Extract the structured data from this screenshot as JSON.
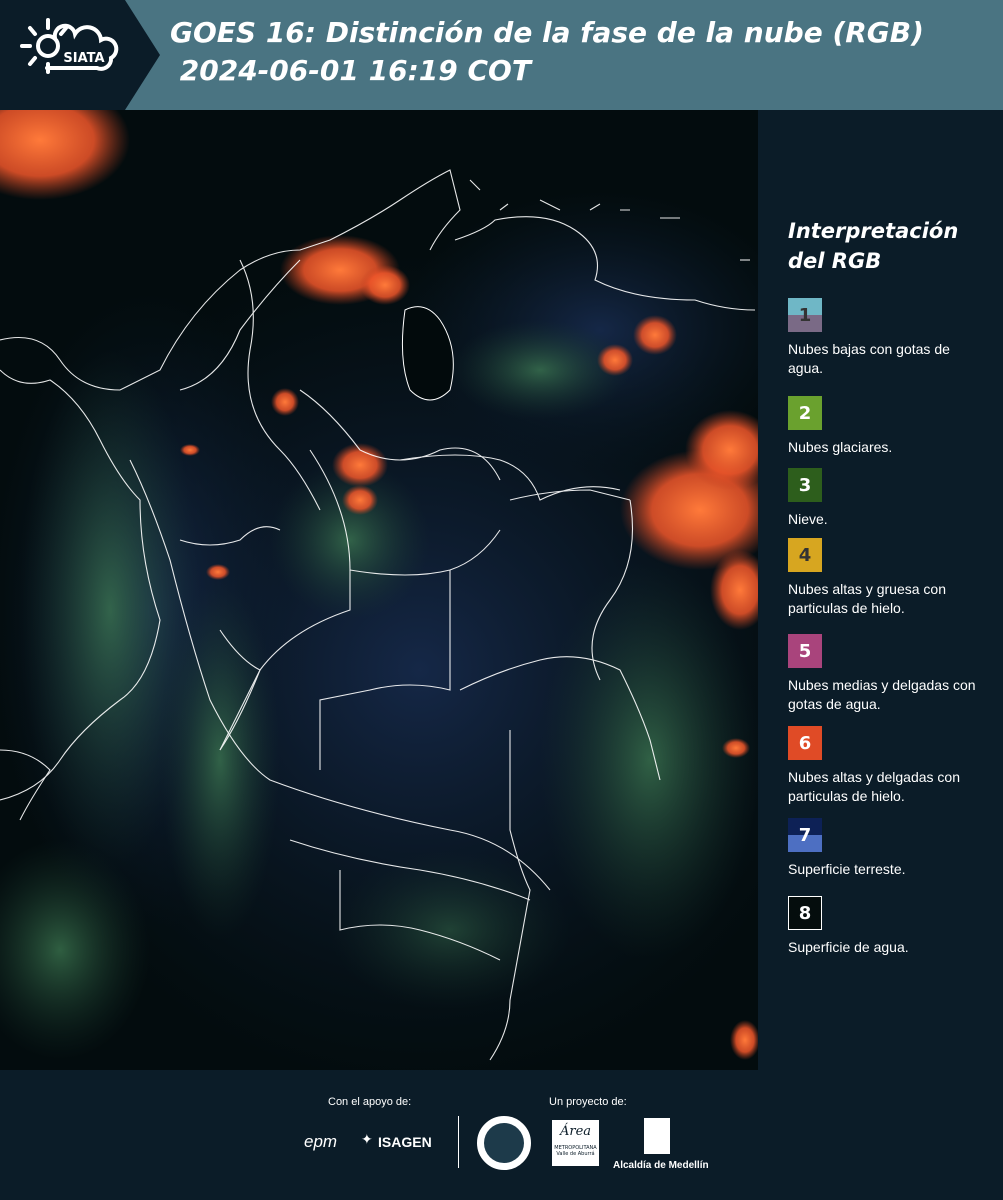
{
  "header": {
    "logo_text": "SIATA",
    "title": "GOES 16: Distinción de la fase de la nube (RGB)\n 2024-06-01 16:19 COT"
  },
  "map": {
    "description_icon": "satellite-rgb-map",
    "colors": {
      "water": "#020b0c",
      "border": "#ffffff"
    }
  },
  "legend": {
    "title": "Interpretación del RGB",
    "items": [
      {
        "num": "1",
        "label": "Nubes bajas con gotas de agua.",
        "color_top": "#6fb7c6",
        "color_bottom": "#7a6a86",
        "num_color": "#333333"
      },
      {
        "num": "2",
        "label": "Nubes glaciares.",
        "color_top": "#6aa12e",
        "color_bottom": "#6aa12e",
        "num_color": "#ffffff"
      },
      {
        "num": "3",
        "label": "Nieve.",
        "color_top": "#2d5e1c",
        "color_bottom": "#2d5e1c",
        "num_color": "#ffffff"
      },
      {
        "num": "4",
        "label": "Nubes altas y gruesa con particulas de hielo.",
        "color_top": "#d7a620",
        "color_bottom": "#d7a620",
        "num_color": "#333333"
      },
      {
        "num": "5",
        "label": "Nubes medias y delgadas con gotas de agua.",
        "color_top": "#a9447c",
        "color_bottom": "#a9447c",
        "num_color": "#ffffff"
      },
      {
        "num": "6",
        "label": "Nubes altas y delgadas con particulas de hielo.",
        "color_top": "#e04b26",
        "color_bottom": "#e04b26",
        "num_color": "#ffffff"
      },
      {
        "num": "7",
        "label": "Superficie terreste.",
        "color_top": "#0d2156",
        "color_bottom": "#4d6fc2",
        "num_color": "#ffffff"
      },
      {
        "num": "8",
        "label": "Superficie de agua.",
        "color_top": "#050d0d",
        "color_bottom": "#050d0d",
        "num_color": "#ffffff"
      }
    ]
  },
  "footer": {
    "support_label": "Con el apoyo de:",
    "project_label": "Un proyecto de:",
    "epm": "epm",
    "isagen": "ISAGEN",
    "area_title": "Área",
    "area_sub1": "METROPOLITANA",
    "area_sub2": "Valle de Aburrá",
    "alcaldia": "Alcaldía de Medellín"
  }
}
